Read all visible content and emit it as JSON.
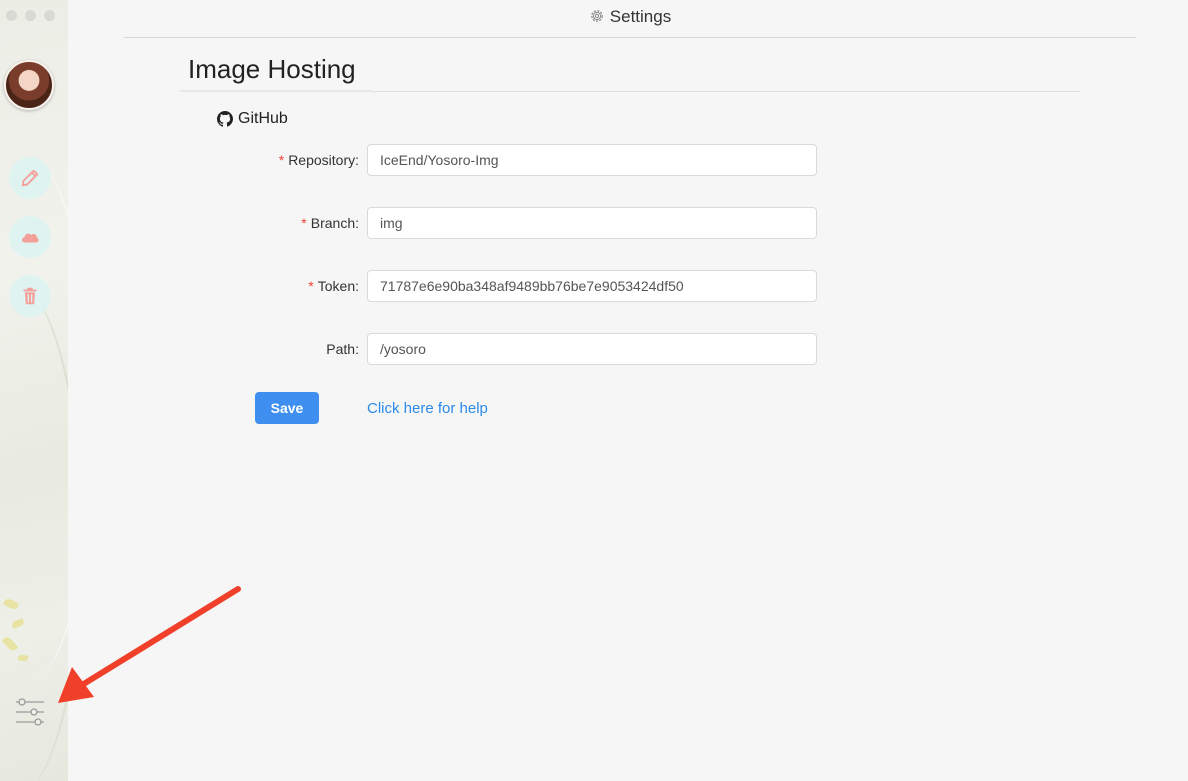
{
  "window": {
    "title": "Settings",
    "title_icon": "gear-icon"
  },
  "sidebar": {
    "items": [
      {
        "name": "edit",
        "icon": "pencil-icon"
      },
      {
        "name": "cloud",
        "icon": "cloud-icon"
      },
      {
        "name": "delete",
        "icon": "trash-icon"
      }
    ],
    "settings_icon": "sliders-icon",
    "accent_color": "#f4a09a",
    "button_bg": "#dff3f1"
  },
  "page": {
    "title": "Image Hosting",
    "section": {
      "title": "GitHub",
      "icon": "github-icon"
    }
  },
  "form": {
    "repository": {
      "label": "Repository",
      "required": true,
      "value": "IceEnd/Yosoro-Img"
    },
    "branch": {
      "label": "Branch",
      "required": true,
      "value": "img"
    },
    "token": {
      "label": "Token",
      "required": true,
      "value": "71787e6e90ba348af9489bb76be7e9053424df50"
    },
    "path": {
      "label": "Path",
      "required": false,
      "value": "/yosoro"
    },
    "required_mark": "*",
    "colon": ":"
  },
  "actions": {
    "save_label": "Save",
    "help_label": "Click here for help",
    "primary_color": "#3f8ff0",
    "link_color": "#2b8be8"
  },
  "annotation": {
    "arrow_color": "#f0402a"
  }
}
